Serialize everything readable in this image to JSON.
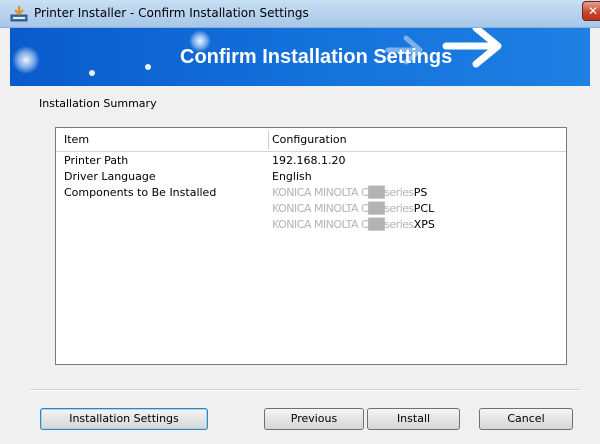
{
  "window": {
    "title": "Printer Installer - Confirm Installation Settings",
    "close_glyph": "✕"
  },
  "banner": {
    "title": "Confirm Installation Settings"
  },
  "summary": {
    "section_label": "Installation Summary",
    "columns": [
      "Item",
      "Configuration"
    ],
    "rows": [
      {
        "item": "Printer Path",
        "values": [
          "192.168.1.20"
        ]
      },
      {
        "item": "Driver Language",
        "values": [
          "English"
        ]
      },
      {
        "item": "Components to Be Installed",
        "values": [
          "PS",
          "PCL",
          "XPS"
        ]
      }
    ],
    "redacted_prefix": "KONICA MINOLTA C██series"
  },
  "buttons": {
    "installation_settings": "Installation Settings",
    "previous": "Previous",
    "install": "Install",
    "cancel": "Cancel"
  },
  "colors": {
    "banner_blue": "#1573dc",
    "title_bar": "#b5d2ee",
    "close_red": "#c7432a"
  },
  "icons": {
    "app": "printer-installer-icon",
    "close": "close-icon",
    "decoration": "arrow-decoration"
  }
}
